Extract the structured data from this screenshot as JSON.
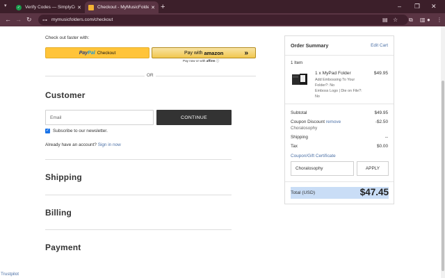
{
  "browser": {
    "tabs": [
      {
        "title": "Verify Codes — SimplyCodes",
        "active": false
      },
      {
        "title": "Checkout - MyMusicFolders",
        "active": true
      }
    ],
    "new_tab": "+",
    "url": "mymusicfolders.com/checkout",
    "window_controls": [
      "–",
      "❐",
      "✕"
    ]
  },
  "checkout": {
    "faster_label": "Check out faster with:",
    "paypal": {
      "pay": "Pay",
      "pal": "Pal",
      "checkout": "Checkout"
    },
    "amazon": {
      "pay_with": "Pay with",
      "brand": "amazon",
      "chevrons": "»",
      "sub_prefix": "Pay now or with",
      "sub_brand": "affirm",
      "sub_info": "ⓘ"
    },
    "or_label": "OR",
    "customer_title": "Customer",
    "email_placeholder": "Email",
    "continue_label": "CONTINUE",
    "newsletter_label": "Subscribe to our newsletter.",
    "newsletter_checked": true,
    "account_prompt": "Already have an account?",
    "signin_link": "Sign in now",
    "shipping_title": "Shipping",
    "billing_title": "Billing",
    "payment_title": "Payment",
    "trustpilot": "Trustpilot"
  },
  "summary": {
    "title": "Order Summary",
    "edit_cart": "Edit Cart",
    "item_count": "1 Item",
    "item": {
      "name": "1 x MyPad Folder",
      "price": "$49.95",
      "options": [
        "Add Embossing To Your",
        "Folder?: No",
        "Emboss Logo | Die on File?:",
        "No"
      ]
    },
    "subtotal_label": "Subtotal",
    "subtotal": "$49.95",
    "coupon_label": "Coupon Discount",
    "coupon_remove": "remove",
    "coupon_code": "Choralosophy",
    "coupon_value": "-$2.50",
    "shipping_label": "Shipping",
    "shipping_value": "--",
    "tax_label": "Tax",
    "tax_value": "$0.00",
    "coupon_gift_link": "Coupon/Gift Certificate",
    "coupon_input_value": "Choralosophy",
    "apply_label": "APPLY",
    "total_label": "Total (USD)",
    "total_value": "$47.45"
  },
  "colors": {
    "tab_strip": "#3c1f2a",
    "toolbar": "#5a3443",
    "paypal_yellow": "#ffc439",
    "continue_dark": "#333333",
    "link_blue": "#4a6fa5",
    "total_highlight": "#c9ddf6"
  }
}
